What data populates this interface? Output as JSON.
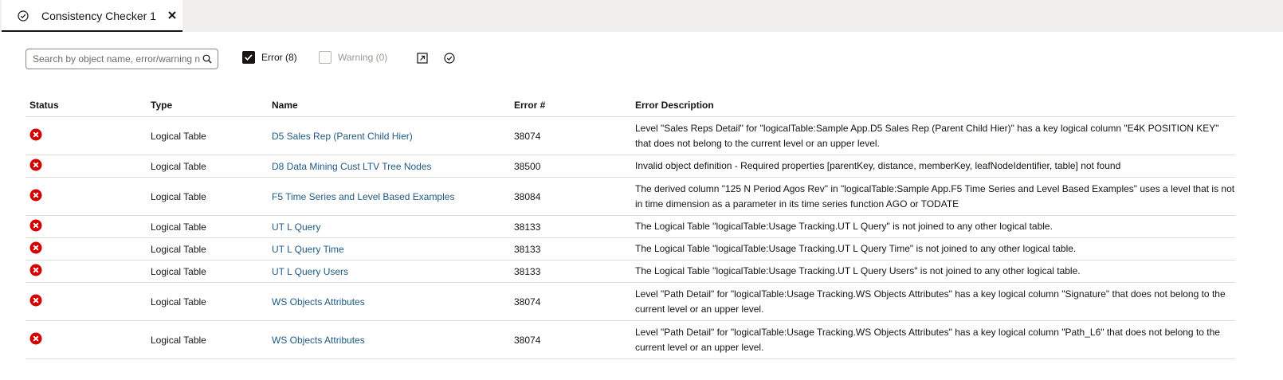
{
  "tab": {
    "label": "Consistency Checker 1"
  },
  "toolbar": {
    "search_placeholder": "Search by object name, error/warning number...",
    "error_filter_label": "Error (8)",
    "warning_filter_label": "Warning (0)",
    "error_checked": true,
    "warning_checked": false
  },
  "colors": {
    "error": "#d30000",
    "link": "#1f5a84",
    "tab_underline": "#161513"
  },
  "table": {
    "headers": {
      "status": "Status",
      "type": "Type",
      "name": "Name",
      "error_num": "Error #",
      "description": "Error Description"
    },
    "rows": [
      {
        "status": "error",
        "type": "Logical Table",
        "name": "D5 Sales Rep (Parent Child Hier)",
        "error_num": "38074",
        "description": "Level \"Sales Reps Detail\" for \"logicalTable:Sample App.D5 Sales Rep (Parent Child Hier)\" has a key logical column \"E4K POSITION KEY\" that does not belong to the current level or an upper level."
      },
      {
        "status": "error",
        "type": "Logical Table",
        "name": "D8 Data Mining Cust LTV Tree Nodes",
        "error_num": "38500",
        "description": "Invalid object definition - Required properties [parentKey, distance, memberKey, leafNodeIdentifier, table] not found"
      },
      {
        "status": "error",
        "type": "Logical Table",
        "name": "F5 Time Series and Level Based Examples",
        "error_num": "38084",
        "description": "The derived column \"125 N Period Agos Rev\" in \"logicalTable:Sample App.F5 Time Series and Level Based Examples\" uses a level that is not in time dimension as a parameter in its time series function AGO or TODATE"
      },
      {
        "status": "error",
        "type": "Logical Table",
        "name": "UT L Query",
        "error_num": "38133",
        "description": "The Logical Table \"logicalTable:Usage Tracking.UT L Query\" is not joined to any other logical table."
      },
      {
        "status": "error",
        "type": "Logical Table",
        "name": "UT L Query Time",
        "error_num": "38133",
        "description": "The Logical Table \"logicalTable:Usage Tracking.UT L Query Time\" is not joined to any other logical table."
      },
      {
        "status": "error",
        "type": "Logical Table",
        "name": "UT L Query Users",
        "error_num": "38133",
        "description": "The Logical Table \"logicalTable:Usage Tracking.UT L Query Users\" is not joined to any other logical table."
      },
      {
        "status": "error",
        "type": "Logical Table",
        "name": "WS Objects Attributes",
        "error_num": "38074",
        "description": "Level \"Path Detail\" for \"logicalTable:Usage Tracking.WS Objects Attributes\" has a key logical column \"Signature\" that does not belong to the current level or an upper level."
      },
      {
        "status": "error",
        "type": "Logical Table",
        "name": "WS Objects Attributes",
        "error_num": "38074",
        "description": "Level \"Path Detail\" for \"logicalTable:Usage Tracking.WS Objects Attributes\" has a key logical column \"Path_L6\" that does not belong to the current level or an upper level."
      }
    ]
  }
}
